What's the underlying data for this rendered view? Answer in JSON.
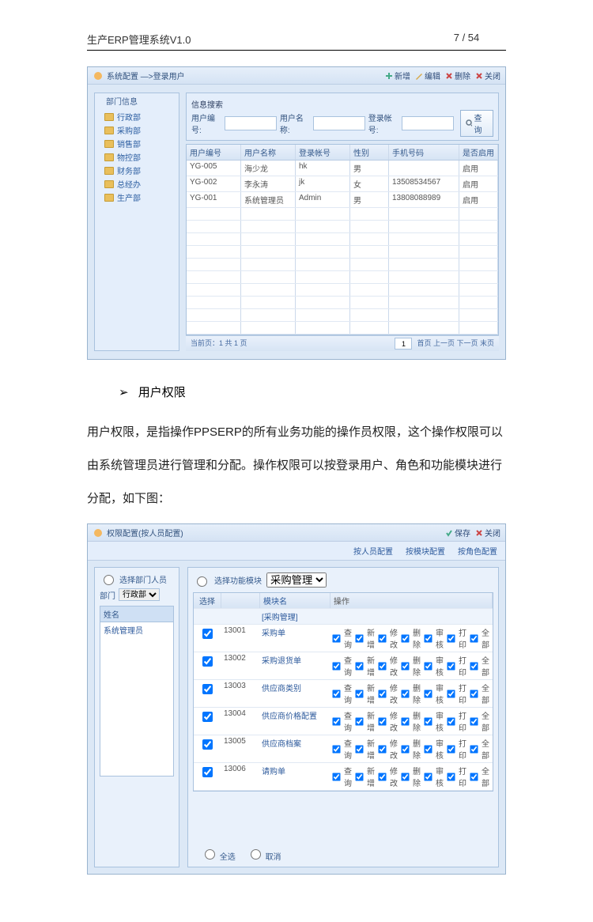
{
  "doc": {
    "title_left": "生产ERP管理系统V1.0",
    "title_right": "7 / 54",
    "bullet": "用户权限",
    "para": "用户权限，是指操作PPSERP的所有业务功能的操作员权限，这个操作权限可以由系统管理员进行管理和分配。操作权限可以按登录用户、角色和功能模块进行分配，如下图："
  },
  "win1": {
    "title": "系统配置 —>登录用户",
    "toolbar": {
      "new": "新增",
      "edit": "编辑",
      "delete": "删除",
      "close": "关闭"
    },
    "tree_title": "部门信息",
    "tree": [
      "行政部",
      "采购部",
      "销售部",
      "物控部",
      "财务部",
      "总经办",
      "生产部"
    ],
    "search": {
      "legend": "信息搜索",
      "user_id": "用户编号:",
      "user_name": "用户名称:",
      "login_acct": "登录帐号:",
      "btn": "查询"
    },
    "grid": {
      "cols": {
        "id": "用户编号",
        "name": "用户名称",
        "acct": "登录帐号",
        "sex": "性别",
        "phone": "手机号码",
        "status": "是否启用"
      },
      "rows": [
        {
          "id": "YG-005",
          "name": "海少龙",
          "acct": "hk",
          "sex": "男",
          "phone": "",
          "status": "启用"
        },
        {
          "id": "YG-002",
          "name": "李永涛",
          "acct": "jk",
          "sex": "女",
          "phone": "13508534567",
          "status": "启用"
        },
        {
          "id": "YG-001",
          "name": "系统管理员",
          "acct": "Admin",
          "sex": "男",
          "phone": "13808088989",
          "status": "启用"
        }
      ],
      "footer_left": "当前页：1 共 1 页",
      "pg": "1",
      "footer_nav": "首页 上一页 下一页 末页"
    }
  },
  "win2": {
    "title": "权限配置(按人员配置)",
    "toolbar": {
      "save": "保存",
      "close": "关闭"
    },
    "links": {
      "by_user": "按人员配置",
      "by_module": "按模块配置",
      "by_role": "按角色配置"
    },
    "left": {
      "radio": "选择部门人员",
      "dept_label": "部门",
      "dept_value": "行政部",
      "list_header": "姓名",
      "list_item": "系统管理员"
    },
    "right": {
      "radio": "选择功能模块",
      "module": "采购管理",
      "cols": {
        "sel": "选择",
        "name": "模块名",
        "ops": "操作"
      },
      "group": "[采购管理]",
      "ops": {
        "query": "查询",
        "add": "新增",
        "edit": "修改",
        "delete": "删除",
        "audit": "审核",
        "print": "打印",
        "all": "全部"
      },
      "rows": [
        {
          "id": "13001",
          "name": "采购单"
        },
        {
          "id": "13002",
          "name": "采购退货单"
        },
        {
          "id": "13003",
          "name": "供应商类别"
        },
        {
          "id": "13004",
          "name": "供应商价格配置"
        },
        {
          "id": "13005",
          "name": "供应商档案"
        },
        {
          "id": "13006",
          "name": "请购单"
        }
      ],
      "radio_all": "全选",
      "radio_none": "取消"
    }
  }
}
